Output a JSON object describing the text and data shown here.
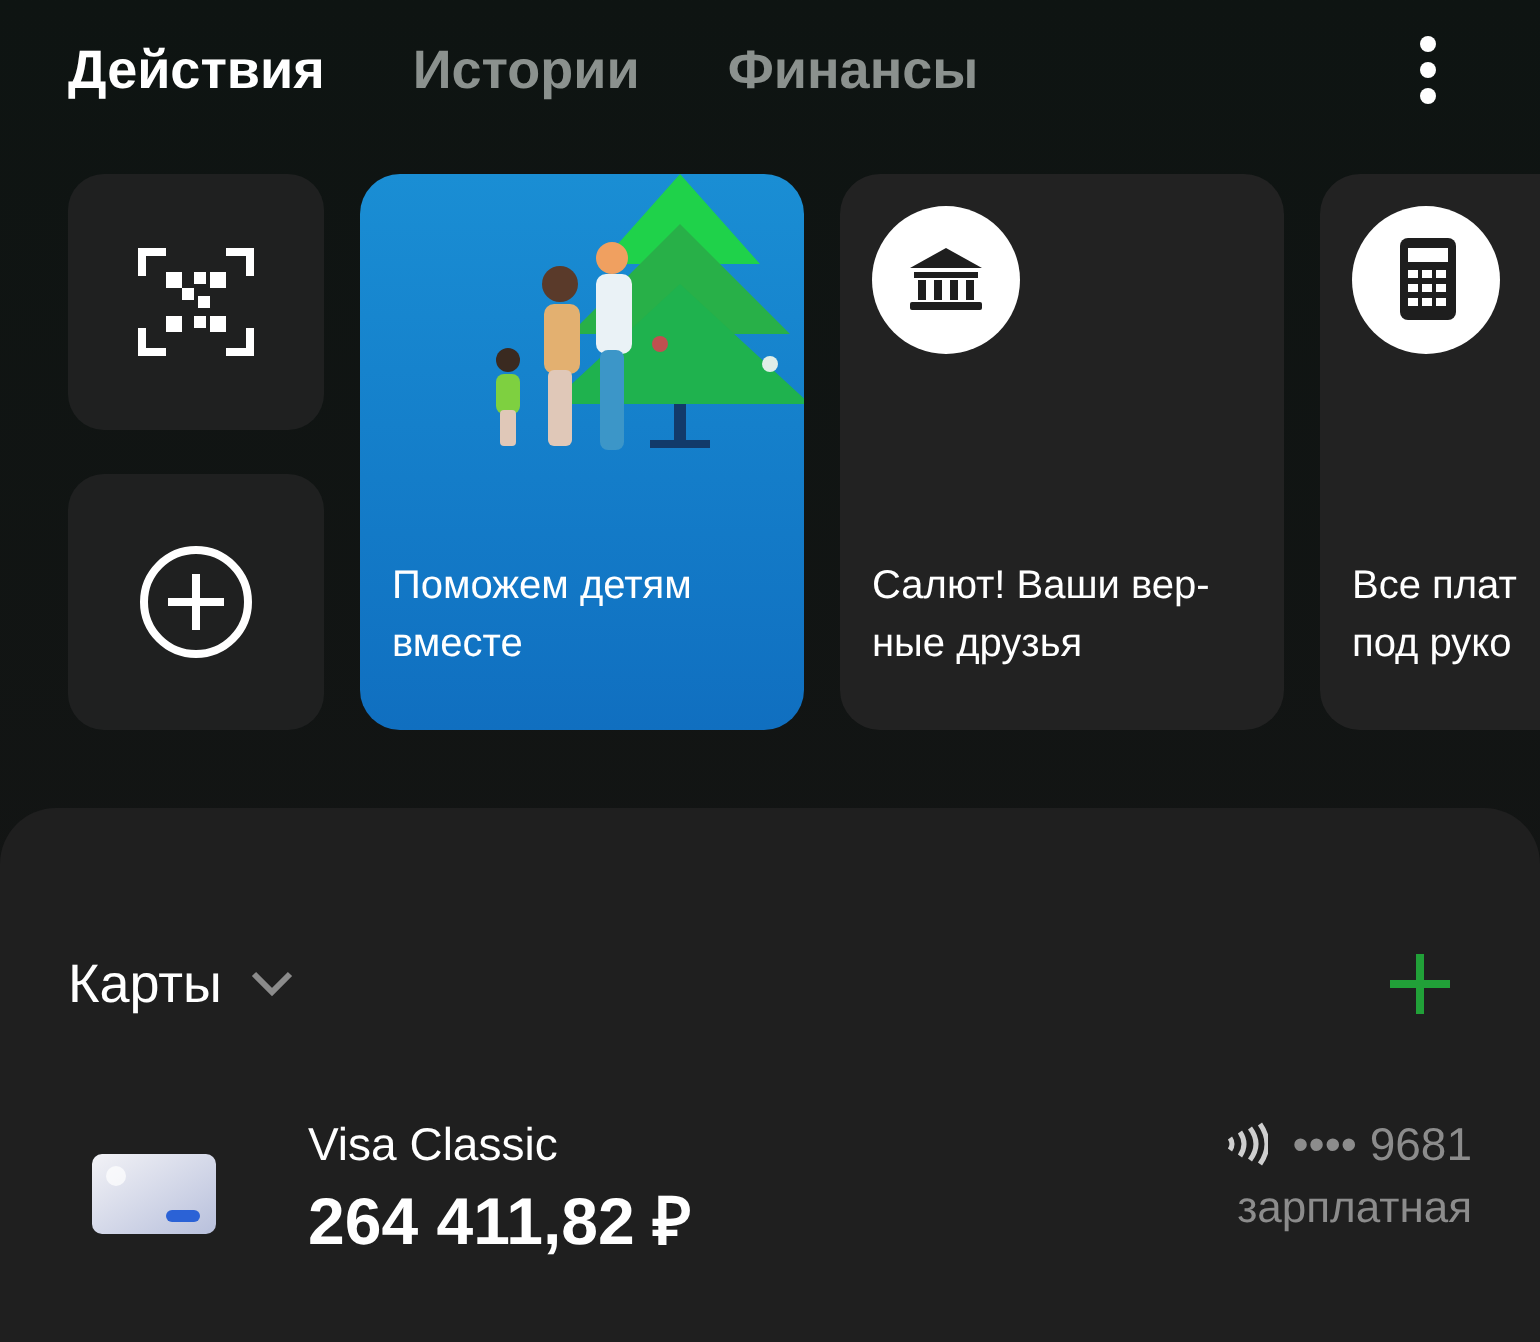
{
  "tabs": [
    {
      "label": "Действия",
      "selected": true
    },
    {
      "label": "Истории",
      "selected": false
    },
    {
      "label": "Финансы",
      "selected": false
    }
  ],
  "quick_actions": [
    {
      "kind": "scan"
    },
    {
      "kind": "add"
    }
  ],
  "stories": [
    {
      "kind": "picture",
      "lines": [
        "Поможем детям",
        "вместе"
      ]
    },
    {
      "kind": "bank",
      "lines": [
        "Салют! Ваши вер-",
        "ные друзья"
      ]
    },
    {
      "kind": "calculator",
      "lines": [
        "Все плат",
        "под руко"
      ]
    }
  ],
  "cards_section": {
    "title": "Карты",
    "items": [
      {
        "name": "Visa Classic",
        "balance": "264 411,82 ₽",
        "contactless": true,
        "number": "•••• 9681",
        "label": "зарплатная"
      }
    ]
  }
}
